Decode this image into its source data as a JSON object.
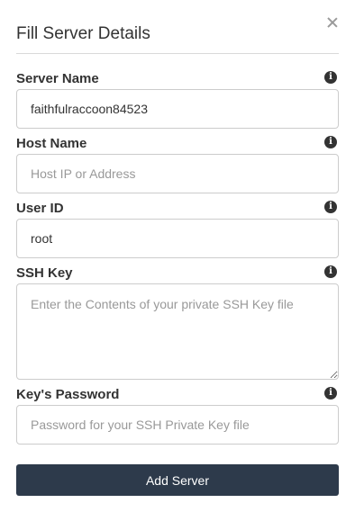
{
  "modal": {
    "title": "Fill Server Details",
    "close_icon": "close-icon"
  },
  "fields": {
    "server_name": {
      "label": "Server Name",
      "value": "faithfulraccoon84523",
      "placeholder": ""
    },
    "host_name": {
      "label": "Host Name",
      "value": "",
      "placeholder": "Host IP or Address"
    },
    "user_id": {
      "label": "User ID",
      "value": "root",
      "placeholder": ""
    },
    "ssh_key": {
      "label": "SSH Key",
      "value": "",
      "placeholder": "Enter the Contents of your private SSH Key file"
    },
    "key_password": {
      "label": "Key's Password",
      "value": "",
      "placeholder": "Password for your SSH Private Key file"
    }
  },
  "info_icon": "info-icon",
  "info_glyph": "i",
  "submit_label": "Add Server",
  "colors": {
    "button_bg": "#2d3a4b",
    "text": "#333333",
    "border": "#cccccc"
  }
}
